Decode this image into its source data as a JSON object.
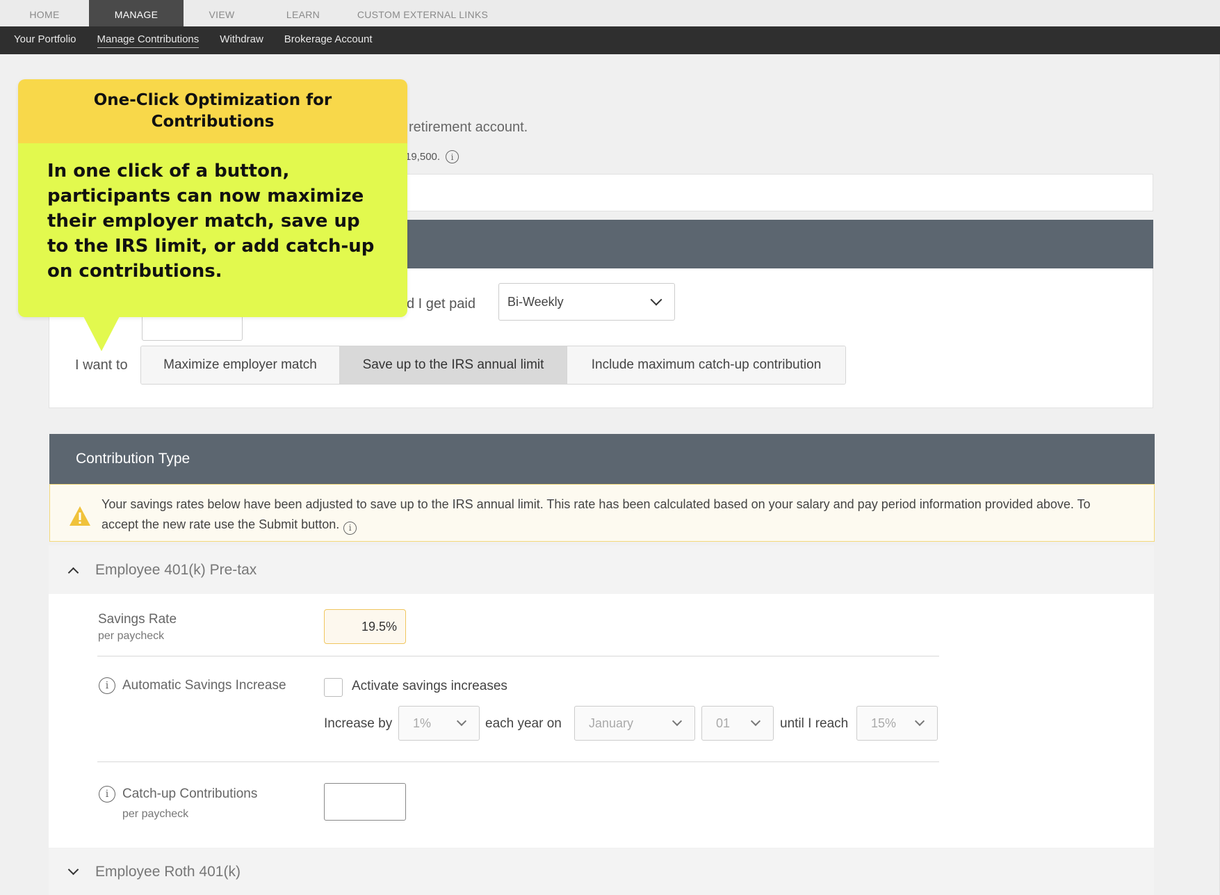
{
  "top_tabs": [
    "HOME",
    "MANAGE",
    "VIEW",
    "LEARN",
    "CUSTOM EXTERNAL LINKS"
  ],
  "sub_nav": [
    "Your Portfolio",
    "Manage Contributions",
    "Withdraw",
    "Brokerage Account"
  ],
  "intro_text": "retirement account.",
  "limit_text": "19,500.",
  "pay": {
    "label": "d I get paid",
    "frequency": "Bi-Weekly"
  },
  "want": {
    "label": "I want to",
    "options": [
      "Maximize employer match",
      "Save up to the IRS annual limit",
      "Include maximum catch-up contribution"
    ],
    "selected": "Save up to the IRS annual limit"
  },
  "contribution_type": {
    "title": "Contribution Type",
    "warning": "Your savings rates below have been adjusted to save up to the IRS annual limit. This rate has been calculated based on your salary and pay period information provided above. To accept the new rate use the Submit button."
  },
  "pretax": {
    "title": "Employee 401(k) Pre-tax",
    "savings_rate_label": "Savings Rate",
    "savings_rate_sub": "per paycheck",
    "savings_rate_value": "19.5%",
    "auto_label": "Automatic Savings Increase",
    "activate_label": "Activate savings increases",
    "increase_by_label": "Increase by",
    "increase_by_value": "1%",
    "each_year_label": "each year on",
    "month_value": "January",
    "day_value": "01",
    "until_label": "until I reach",
    "until_value": "15%",
    "catchup_label": "Catch-up Contributions",
    "catchup_sub": "per paycheck"
  },
  "roth": {
    "title": "Employee Roth 401(k)"
  },
  "callout": {
    "title": "One-Click Optimization for Contributions",
    "body": "In one click of a button, participants can now maximize their employer match, save up to the IRS limit, or add catch-up on contributions.",
    "colors": {
      "header": "#f8d84a",
      "body": "#e2f94e"
    }
  },
  "colors": {
    "nav_dark": "#2f2f2f",
    "section_header": "#5c6670",
    "warning_border": "#f3d97a"
  }
}
